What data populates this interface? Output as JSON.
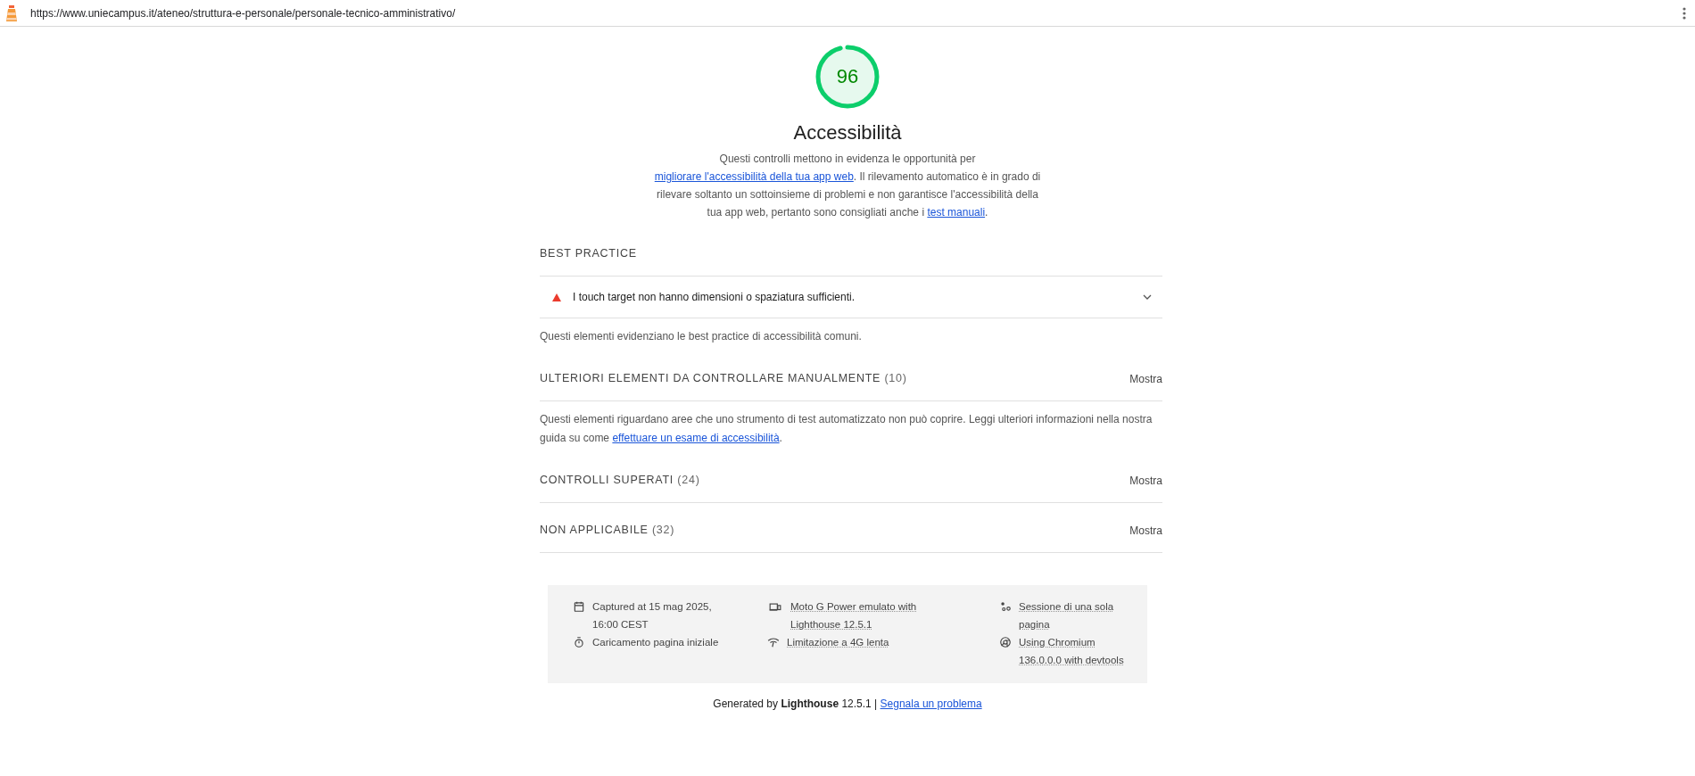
{
  "address_bar": {
    "url": "https://www.uniecampus.it/ateneo/struttura-e-personale/personale-tecnico-amministrativo/"
  },
  "score": {
    "value": "96",
    "title": "Accessibilità",
    "description": [
      {
        "kind": "text",
        "text": "Questi controlli mettono in evidenza le opportunità per "
      },
      {
        "kind": "link",
        "text": "migliorare l'accessibilità della tua app web"
      },
      {
        "kind": "text",
        "text": ". Il rilevamento automatico è in grado di rilevare soltanto un sottoinsieme di problemi e non garantisce l'accessibilità della tua app web, pertanto sono consigliati anche i "
      },
      {
        "kind": "link",
        "text": "test manuali"
      },
      {
        "kind": "text",
        "text": "."
      }
    ]
  },
  "sections": [
    {
      "title": "BEST PRACTICE",
      "audits": [
        {
          "kind": "fail",
          "text": "I touch target non hanno dimensioni o spaziatura sufficienti.",
          "expanded": false
        }
      ],
      "description": [
        {
          "kind": "text",
          "text": "Questi elementi evidenziano le best practice di accessibilità comuni."
        }
      ]
    },
    {
      "title": "ULTERIORI ELEMENTI DA CONTROLLARE MANUALMENTE",
      "count": "(10)",
      "toggle": "Mostra",
      "description": [
        {
          "kind": "text",
          "text": "Questi elementi riguardano aree che uno strumento di test automatizzato non può coprire. Leggi ulteriori informazioni nella nostra guida su come "
        },
        {
          "kind": "link",
          "text": "effettuare un esame di accessibilità"
        },
        {
          "kind": "text",
          "text": "."
        }
      ]
    },
    {
      "title": "CONTROLLI SUPERATI",
      "count": "(24)",
      "toggle": "Mostra"
    },
    {
      "title": "NON APPLICABILE",
      "count": "(32)",
      "toggle": "Mostra"
    }
  ],
  "run_info": [
    {
      "kind": "calendar",
      "text": "Captured at 15 mag 2025, 16:00 CEST",
      "dotted_underline": false
    },
    {
      "kind": "device",
      "text": "Moto G Power emulato with Lighthouse 12.5.1",
      "dotted_underline": true
    },
    {
      "kind": "session",
      "text": "Sessione di una sola pagina",
      "dotted_underline": true
    },
    {
      "kind": "timer",
      "text": "Caricamento pagina iniziale",
      "dotted_underline": false
    },
    {
      "kind": "network",
      "text": "Limitazione a 4G lenta",
      "dotted_underline": true
    },
    {
      "kind": "chromium",
      "text": "Using Chromium 136.0.0.0 with devtools",
      "dotted_underline": true
    }
  ],
  "footer": {
    "text": "Generated by **Lighthouse** 12.5.1 |",
    "link": "Segnala un problema"
  }
}
